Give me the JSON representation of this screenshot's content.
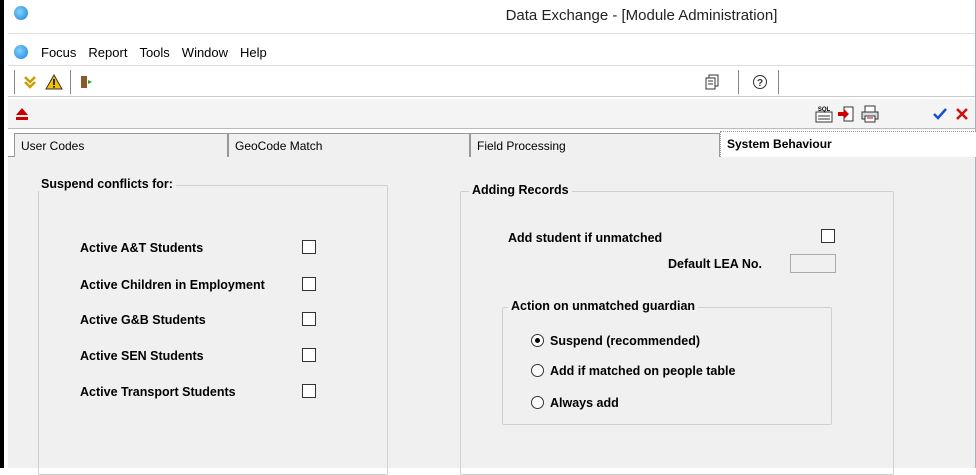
{
  "window": {
    "title": "Data Exchange - [Module Administration]"
  },
  "menu": {
    "items": [
      "Focus",
      "Report",
      "Tools",
      "Window",
      "Help"
    ]
  },
  "tabs": [
    {
      "label": "User Codes",
      "active": false
    },
    {
      "label": "GeoCode Match",
      "active": false
    },
    {
      "label": "Field Processing",
      "active": false
    },
    {
      "label": "System Behaviour",
      "active": true
    }
  ],
  "suspend_group": {
    "title": "Suspend conflicts for:",
    "items": [
      {
        "label": "Active A&T Students",
        "checked": false
      },
      {
        "label": "Active Children in Employment",
        "checked": false
      },
      {
        "label": "Active G&B Students",
        "checked": false
      },
      {
        "label": "Active SEN Students",
        "checked": false
      },
      {
        "label": "Active Transport Students",
        "checked": false
      }
    ]
  },
  "adding_group": {
    "title": "Adding Records",
    "add_student_label": "Add student if unmatched",
    "add_student_checked": false,
    "default_lea_label": "Default LEA No.",
    "default_lea_value": "",
    "guardian_group": {
      "title": "Action on unmatched guardian",
      "options": [
        {
          "label": "Suspend (recommended)",
          "selected": true
        },
        {
          "label": "Add if matched on people table",
          "selected": false
        },
        {
          "label": "Always add",
          "selected": false
        }
      ]
    }
  },
  "icons": {
    "toolbar1": [
      "download-arrow-icon",
      "warning-icon",
      "exit-door-icon",
      "copy-icon",
      "help-icon"
    ],
    "toolbar2": [
      "eject-icon",
      "sql-icon",
      "import-icon",
      "print-icon",
      "confirm-check-icon",
      "cancel-x-icon"
    ]
  },
  "colors": {
    "confirm": "#1a4fd6",
    "cancel": "#d01010",
    "eject": "#cc0000",
    "warning": "#f2c200"
  }
}
